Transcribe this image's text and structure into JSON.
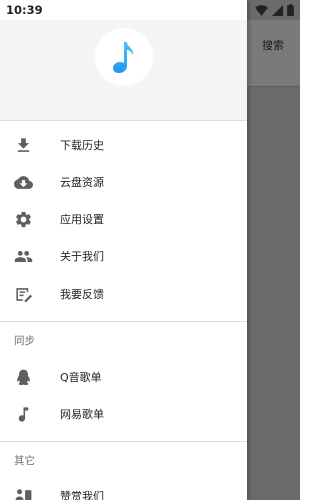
{
  "status_bar": {
    "time": "10:39",
    "icons": [
      "wifi-icon",
      "signal-icon",
      "battery-icon"
    ]
  },
  "background_app": {
    "search_label": "搜索"
  },
  "drawer": {
    "logo_icon": "music-note-icon",
    "menu": [
      {
        "icon": "download-icon",
        "label": "下载历史"
      },
      {
        "icon": "cloud-download-icon",
        "label": "云盘资源"
      },
      {
        "icon": "settings-icon",
        "label": "应用设置"
      },
      {
        "icon": "people-icon",
        "label": "关于我们"
      },
      {
        "icon": "feedback-icon",
        "label": "我要反馈"
      }
    ],
    "sync_section": {
      "title": "同步",
      "items": [
        {
          "icon": "qq-icon",
          "label": "Q音歌单"
        },
        {
          "icon": "music-note-icon",
          "label": "网易歌单"
        }
      ]
    },
    "other_section": {
      "title": "其它",
      "items": [
        {
          "icon": "reward-icon",
          "label": "赞赏我们"
        }
      ]
    }
  },
  "colors": {
    "accent_blue": "#2196f3",
    "icon_gray": "#5f5f5f",
    "scrim": "#6b6b6b"
  }
}
